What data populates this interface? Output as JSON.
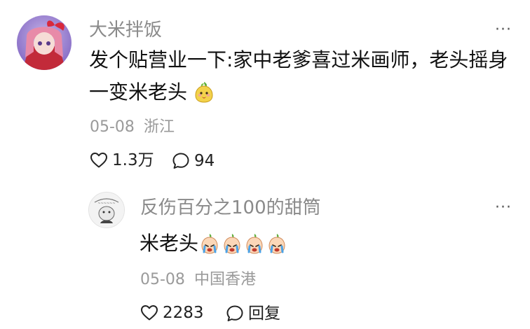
{
  "main_comment": {
    "username": "大米拌饭",
    "text_line1": "发个贴营业一下:家中老爹喜过米画师，老头摇身",
    "text_line2": "一变米老头",
    "date": "05-08",
    "location": "浙江",
    "likes": "1.3万",
    "comments": "94",
    "more_label": "···"
  },
  "reply": {
    "username": "反伤百分之100的甜筒",
    "text": "米老头",
    "date": "05-08",
    "location": "中国香港",
    "likes": "2283",
    "reply_label": "回复",
    "more_label": "···"
  },
  "icons": {
    "heart": "heart-outline-icon",
    "comment": "chat-bubble-icon",
    "sticker": "pear-face-emoji",
    "crying": "crying-face-emoji"
  },
  "colors": {
    "username": "#8a8a8a",
    "meta": "#9a9a9a",
    "text": "#111111"
  }
}
